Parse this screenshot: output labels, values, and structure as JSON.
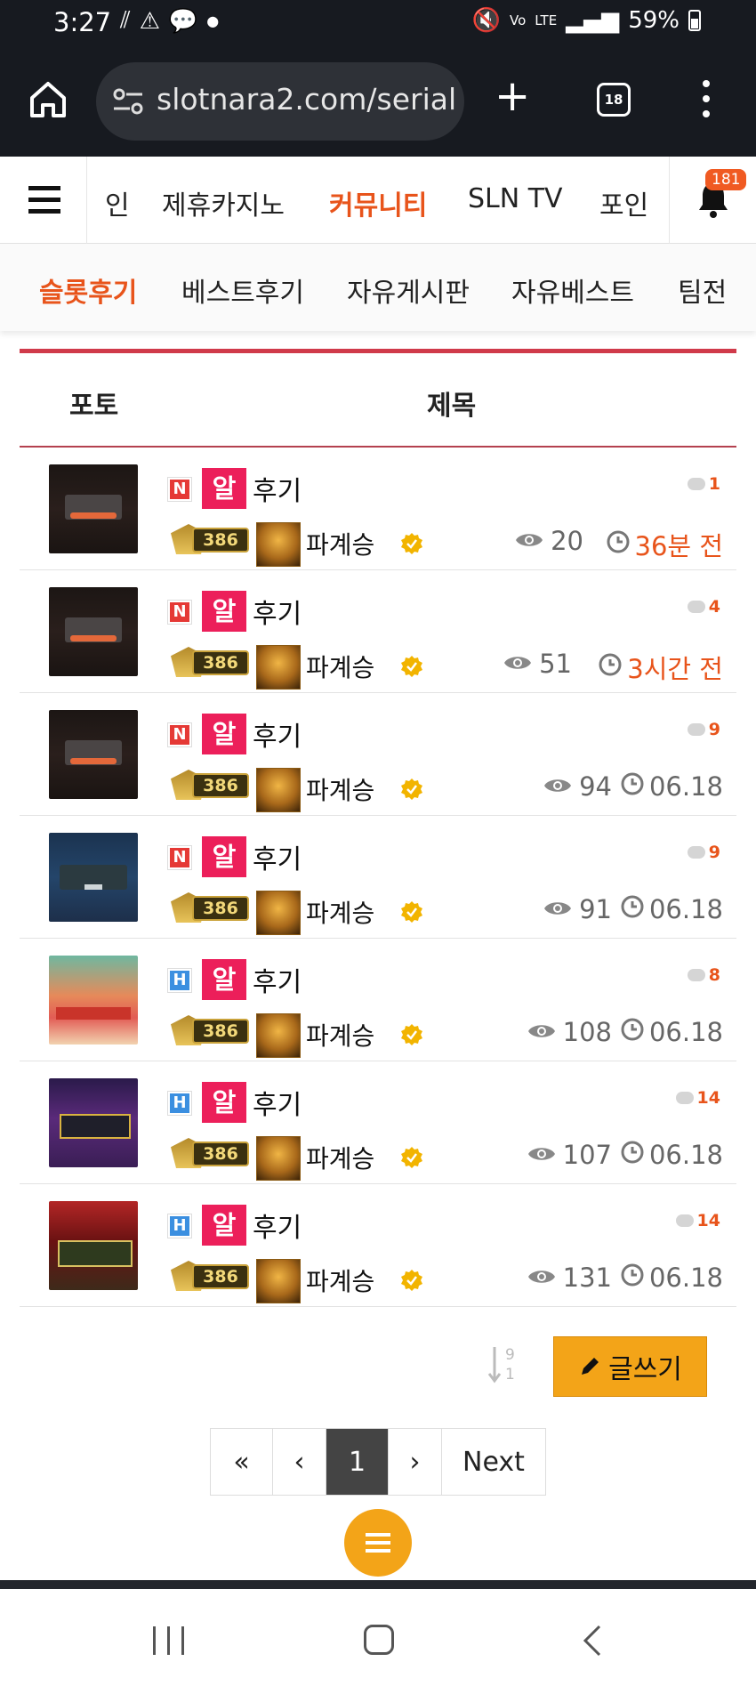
{
  "status_bar": {
    "time": "3:27",
    "battery": "59%",
    "network": "LTE"
  },
  "browser": {
    "url": "slotnara2.com/serial",
    "tab_count": "18"
  },
  "site_nav": {
    "items": [
      "인",
      "제휴카지노",
      "커뮤니티",
      "SLN TV",
      "포인"
    ],
    "active": "커뮤니티",
    "notification_count": "181"
  },
  "sub_nav": {
    "items": [
      "슬롯후기",
      "베스트후기",
      "자유게시판",
      "자유베스트",
      "팀전"
    ],
    "active": "슬롯후기"
  },
  "board": {
    "headers": {
      "photo": "포토",
      "title": "제목"
    },
    "posts": [
      {
        "badge": "N",
        "tag": "알",
        "title": "후기",
        "comments": "1",
        "level": "386",
        "author": "파계승",
        "views": "20",
        "time": "36분 전",
        "recent": true,
        "thumb": "dark"
      },
      {
        "badge": "N",
        "tag": "알",
        "title": "후기",
        "comments": "4",
        "level": "386",
        "author": "파계승",
        "views": "51",
        "time": "3시간 전",
        "recent": true,
        "thumb": "dark"
      },
      {
        "badge": "N",
        "tag": "알",
        "title": "후기",
        "comments": "9",
        "level": "386",
        "author": "파계승",
        "views": "94",
        "time": "06.18",
        "recent": false,
        "thumb": "dark"
      },
      {
        "badge": "N",
        "tag": "알",
        "title": "후기",
        "comments": "9",
        "level": "386",
        "author": "파계승",
        "views": "91",
        "time": "06.18",
        "recent": false,
        "thumb": "blue"
      },
      {
        "badge": "H",
        "tag": "알",
        "title": "후기",
        "comments": "8",
        "level": "386",
        "author": "파계승",
        "views": "108",
        "time": "06.18",
        "recent": false,
        "thumb": "fruit"
      },
      {
        "badge": "H",
        "tag": "알",
        "title": "후기",
        "comments": "14",
        "level": "386",
        "author": "파계승",
        "views": "107",
        "time": "06.18",
        "recent": false,
        "thumb": "purple"
      },
      {
        "badge": "H",
        "tag": "알",
        "title": "후기",
        "comments": "14",
        "level": "386",
        "author": "파계승",
        "views": "131",
        "time": "06.18",
        "recent": false,
        "thumb": "red"
      }
    ]
  },
  "actions": {
    "sort_top": "9",
    "sort_bottom": "1",
    "write_label": "글쓰기"
  },
  "pagination": {
    "first": "«",
    "prev": "‹",
    "current": "1",
    "next_arrow": "›",
    "next": "Next"
  },
  "colors": {
    "accent": "#e8541b",
    "tag": "#ec1f5a",
    "button": "#f3a418",
    "divider": "#d03a4a"
  }
}
